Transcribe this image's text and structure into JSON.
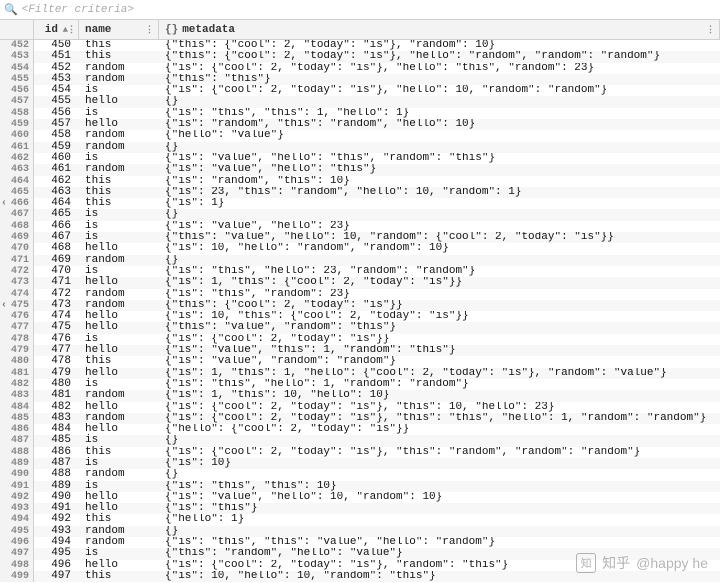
{
  "filter": {
    "placeholder": "<Filter criteria>"
  },
  "columns": {
    "id": "id",
    "name": "name",
    "metadata": "metadata"
  },
  "marker_rows": [
    466,
    475
  ],
  "watermark": {
    "site": "知乎",
    "user": "@happy he"
  },
  "rows": [
    {
      "n": 452,
      "id": 450,
      "name": "this",
      "meta": "{\"this\": {\"cool\": 2, \"today\": \"is\"}, \"random\": 10}"
    },
    {
      "n": 453,
      "id": 451,
      "name": "this",
      "meta": "{\"this\": {\"cool\": 2, \"today\": \"is\"}, \"hello\": \"random\", \"random\": \"random\"}"
    },
    {
      "n": 454,
      "id": 452,
      "name": "random",
      "meta": "{\"is\": {\"cool\": 2, \"today\": \"is\"}, \"hello\": \"this\", \"random\": 23}"
    },
    {
      "n": 455,
      "id": 453,
      "name": "random",
      "meta": "{\"this\": \"this\"}"
    },
    {
      "n": 456,
      "id": 454,
      "name": "is",
      "meta": "{\"is\": {\"cool\": 2, \"today\": \"is\"}, \"hello\": 10, \"random\": \"random\"}"
    },
    {
      "n": 457,
      "id": 455,
      "name": "hello",
      "meta": "{}"
    },
    {
      "n": 458,
      "id": 456,
      "name": "is",
      "meta": "{\"is\": \"this\", \"this\": 1, \"hello\": 1}"
    },
    {
      "n": 459,
      "id": 457,
      "name": "hello",
      "meta": "{\"is\": \"random\", \"this\": \"random\", \"hello\": 10}"
    },
    {
      "n": 460,
      "id": 458,
      "name": "random",
      "meta": "{\"hello\": \"value\"}"
    },
    {
      "n": 461,
      "id": 459,
      "name": "random",
      "meta": "{}"
    },
    {
      "n": 462,
      "id": 460,
      "name": "is",
      "meta": "{\"is\": \"value\", \"hello\": \"this\", \"random\": \"this\"}"
    },
    {
      "n": 463,
      "id": 461,
      "name": "random",
      "meta": "{\"is\": \"value\", \"hello\": \"this\"}"
    },
    {
      "n": 464,
      "id": 462,
      "name": "this",
      "meta": "{\"is\": \"random\", \"this\": 10}"
    },
    {
      "n": 465,
      "id": 463,
      "name": "this",
      "meta": "{\"is\": 23, \"this\": \"random\", \"hello\": 10, \"random\": 1}"
    },
    {
      "n": 466,
      "id": 464,
      "name": "this",
      "meta": "{\"is\": 1}"
    },
    {
      "n": 467,
      "id": 465,
      "name": "is",
      "meta": "{}"
    },
    {
      "n": 468,
      "id": 466,
      "name": "is",
      "meta": "{\"is\": \"value\", \"hello\": 23}"
    },
    {
      "n": 469,
      "id": 467,
      "name": "is",
      "meta": "{\"this\": \"value\", \"hello\": 10, \"random\": {\"cool\": 2, \"today\": \"is\"}}"
    },
    {
      "n": 470,
      "id": 468,
      "name": "hello",
      "meta": "{\"is\": 10, \"hello\": \"random\", \"random\": 10}"
    },
    {
      "n": 471,
      "id": 469,
      "name": "random",
      "meta": "{}"
    },
    {
      "n": 472,
      "id": 470,
      "name": "is",
      "meta": "{\"is\": \"this\", \"hello\": 23, \"random\": \"random\"}"
    },
    {
      "n": 473,
      "id": 471,
      "name": "hello",
      "meta": "{\"is\": 1, \"this\": {\"cool\": 2, \"today\": \"is\"}}"
    },
    {
      "n": 474,
      "id": 472,
      "name": "random",
      "meta": "{\"is\": \"this\", \"random\": 23}"
    },
    {
      "n": 475,
      "id": 473,
      "name": "random",
      "meta": "{\"this\": {\"cool\": 2, \"today\": \"is\"}}"
    },
    {
      "n": 476,
      "id": 474,
      "name": "hello",
      "meta": "{\"is\": 10, \"this\": {\"cool\": 2, \"today\": \"is\"}}"
    },
    {
      "n": 477,
      "id": 475,
      "name": "hello",
      "meta": "{\"this\": \"value\", \"random\": \"this\"}"
    },
    {
      "n": 478,
      "id": 476,
      "name": "is",
      "meta": "{\"is\": {\"cool\": 2, \"today\": \"is\"}}"
    },
    {
      "n": 479,
      "id": 477,
      "name": "hello",
      "meta": "{\"is\": \"value\", \"this\": 1, \"random\": \"this\"}"
    },
    {
      "n": 480,
      "id": 478,
      "name": "this",
      "meta": "{\"is\": \"value\", \"random\": \"random\"}"
    },
    {
      "n": 481,
      "id": 479,
      "name": "hello",
      "meta": "{\"is\": 1, \"this\": 1, \"hello\": {\"cool\": 2, \"today\": \"is\"}, \"random\": \"value\"}"
    },
    {
      "n": 482,
      "id": 480,
      "name": "is",
      "meta": "{\"is\": \"this\", \"hello\": 1, \"random\": \"random\"}"
    },
    {
      "n": 483,
      "id": 481,
      "name": "random",
      "meta": "{\"is\": 1, \"this\": 10, \"hello\": 10}"
    },
    {
      "n": 484,
      "id": 482,
      "name": "hello",
      "meta": "{\"is\": {\"cool\": 2, \"today\": \"is\"}, \"this\": 10, \"hello\": 23}"
    },
    {
      "n": 485,
      "id": 483,
      "name": "random",
      "meta": "{\"is\": {\"cool\": 2, \"today\": \"is\"}, \"this\": \"this\", \"hello\": 1, \"random\": \"random\"}"
    },
    {
      "n": 486,
      "id": 484,
      "name": "hello",
      "meta": "{\"hello\": {\"cool\": 2, \"today\": \"is\"}}"
    },
    {
      "n": 487,
      "id": 485,
      "name": "is",
      "meta": "{}"
    },
    {
      "n": 488,
      "id": 486,
      "name": "this",
      "meta": "{\"is\": {\"cool\": 2, \"today\": \"is\"}, \"this\": \"random\", \"random\": \"random\"}"
    },
    {
      "n": 489,
      "id": 487,
      "name": "is",
      "meta": "{\"is\": 10}"
    },
    {
      "n": 490,
      "id": 488,
      "name": "random",
      "meta": "{}"
    },
    {
      "n": 491,
      "id": 489,
      "name": "is",
      "meta": "{\"is\": \"this\", \"this\": 10}"
    },
    {
      "n": 492,
      "id": 490,
      "name": "hello",
      "meta": "{\"is\": \"value\", \"hello\": 10, \"random\": 10}"
    },
    {
      "n": 493,
      "id": 491,
      "name": "hello",
      "meta": "{\"is\": \"this\"}"
    },
    {
      "n": 494,
      "id": 492,
      "name": "this",
      "meta": "{\"hello\": 1}"
    },
    {
      "n": 495,
      "id": 493,
      "name": "random",
      "meta": "{}"
    },
    {
      "n": 496,
      "id": 494,
      "name": "random",
      "meta": "{\"is\": \"this\", \"this\": \"value\", \"hello\": \"random\"}"
    },
    {
      "n": 497,
      "id": 495,
      "name": "is",
      "meta": "{\"this\": \"random\", \"hello\": \"value\"}"
    },
    {
      "n": 498,
      "id": 496,
      "name": "hello",
      "meta": "{\"is\": {\"cool\": 2, \"today\": \"is\"}, \"random\": \"this\"}"
    },
    {
      "n": 499,
      "id": 497,
      "name": "this",
      "meta": "{\"is\": 10, \"hello\": 10, \"random\": \"this\"}"
    }
  ]
}
